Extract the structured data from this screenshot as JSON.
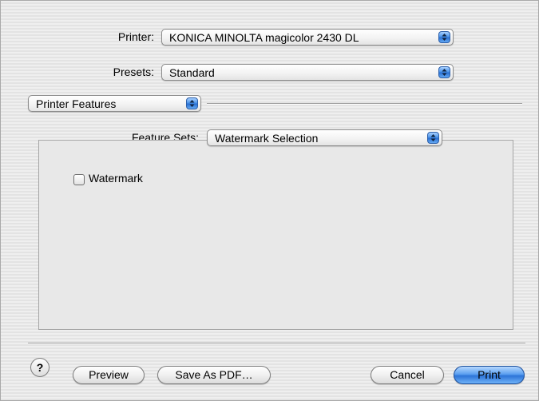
{
  "printer": {
    "label": "Printer:",
    "value": "KONICA MINOLTA magicolor 2430 DL"
  },
  "presets": {
    "label": "Presets:",
    "value": "Standard"
  },
  "panel_selector": {
    "value": "Printer Features"
  },
  "feature_sets": {
    "label": "Feature Sets:",
    "value": "Watermark Selection"
  },
  "watermark": {
    "label": "Watermark",
    "checked": false
  },
  "buttons": {
    "help": "?",
    "preview": "Preview",
    "save_pdf": "Save As PDF…",
    "cancel": "Cancel",
    "print": "Print"
  },
  "colors": {
    "accent_blue": "#2d74d8",
    "background": "#ececec"
  }
}
